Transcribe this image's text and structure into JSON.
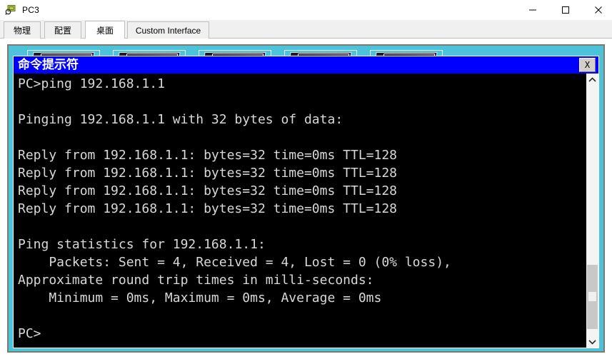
{
  "window": {
    "title": "PC3",
    "icon": "pc-device-icon",
    "controls": {
      "minimize": "minimize-icon",
      "maximize": "maximize-icon",
      "close": "close-icon"
    }
  },
  "tabs": [
    {
      "label": "物理",
      "name": "tab-physical",
      "active": false
    },
    {
      "label": "配置",
      "name": "tab-config",
      "active": false
    },
    {
      "label": "桌面",
      "name": "tab-desktop",
      "active": true
    },
    {
      "label": "Custom Interface",
      "name": "tab-custom-interface",
      "active": false
    }
  ],
  "desktop": {
    "background_color": "#4cc3d9",
    "icons": [
      {
        "name": "desktop-icon-1"
      },
      {
        "name": "desktop-icon-2"
      },
      {
        "name": "desktop-icon-3"
      },
      {
        "name": "desktop-icon-4"
      },
      {
        "name": "desktop-icon-5"
      }
    ]
  },
  "command_prompt": {
    "title": "命令提示符",
    "titlebar_color": "#0000ff",
    "close_label": "X",
    "background_color": "#000000",
    "text_color": "#d8d8d8",
    "lines": [
      "PC>ping 192.168.1.1",
      "",
      "Pinging 192.168.1.1 with 32 bytes of data:",
      "",
      "Reply from 192.168.1.1: bytes=32 time=0ms TTL=128",
      "Reply from 192.168.1.1: bytes=32 time=0ms TTL=128",
      "Reply from 192.168.1.1: bytes=32 time=0ms TTL=128",
      "Reply from 192.168.1.1: bytes=32 time=0ms TTL=128",
      "",
      "Ping statistics for 192.168.1.1:",
      "    Packets: Sent = 4, Received = 4, Lost = 0 (0% loss),",
      "Approximate round trip times in milli-seconds:",
      "    Minimum = 0ms, Maximum = 0ms, Average = 0ms",
      "",
      "PC>"
    ],
    "scrollbar": {
      "up_arrow": "chevron-up-icon",
      "down_arrow": "chevron-down-icon"
    }
  }
}
